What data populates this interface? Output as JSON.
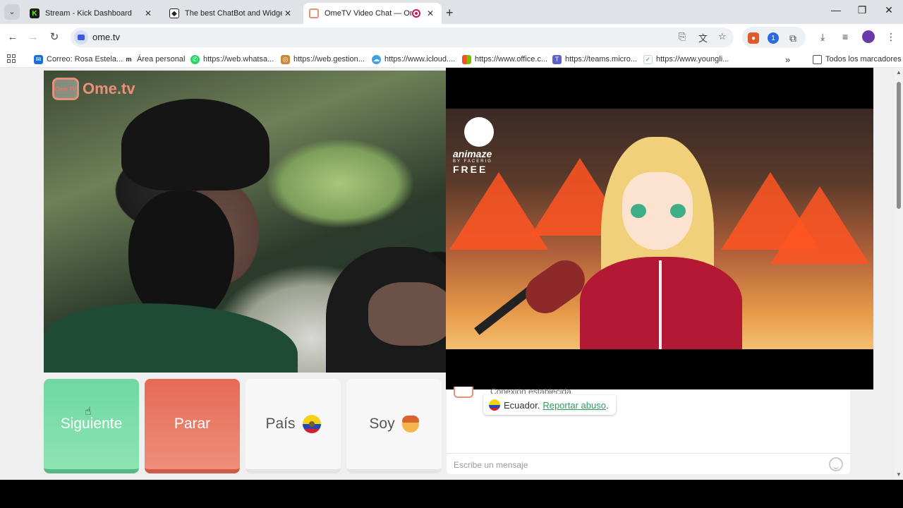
{
  "browser": {
    "tabs": [
      {
        "title": "Stream - Kick Dashboard",
        "favicon_color": "#53fc18"
      },
      {
        "title": "The best ChatBot and Widgets",
        "favicon_color": "#222222"
      },
      {
        "title": "OmeTV Video Chat — Ome",
        "favicon_color": "#e8907b"
      }
    ],
    "address": "ome.tv",
    "bookmarks": [
      "Correo: Rosa Estela...",
      "Área personal",
      "https://web.whatsa...",
      "https://web.gestion...",
      "https://www.icloud....",
      "https://www.office.c...",
      "https://teams.micro...",
      "https://www.youngli..."
    ],
    "all_bookmarks": "Todos los marcadores"
  },
  "site": {
    "logo_badge": "Ome TV",
    "logo_text": "Ome.tv"
  },
  "overlay": {
    "brand": "animaze",
    "by": "BY FACERIG",
    "free": "FREE"
  },
  "controls": {
    "next": "Siguiente",
    "stop": "Parar",
    "country": "País",
    "soy": "Soy"
  },
  "chat": {
    "status": "Conexión establecida.",
    "country": "Ecuador.",
    "report": "Reportar abuso",
    "period": ".",
    "placeholder": "Escribe un mensaje"
  },
  "colors": {
    "next_button": "#6fd8a0",
    "stop_button": "#e66a55",
    "link_green": "#2e9a5e"
  }
}
